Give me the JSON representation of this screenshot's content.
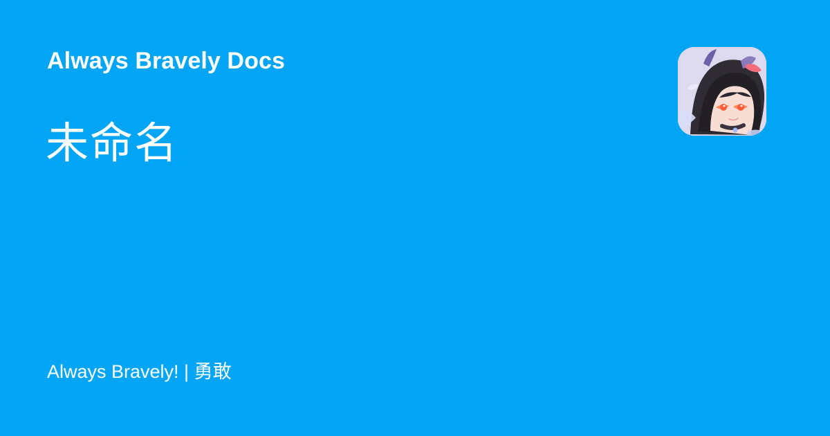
{
  "site": {
    "title": "Always Bravely Docs",
    "tagline": "Always Bravely! | 勇敢"
  },
  "page": {
    "title": "未命名"
  },
  "colors": {
    "background": "#03a5f4",
    "text": "#ffffff"
  },
  "avatar": {
    "icon": "anime-avatar-icon"
  }
}
